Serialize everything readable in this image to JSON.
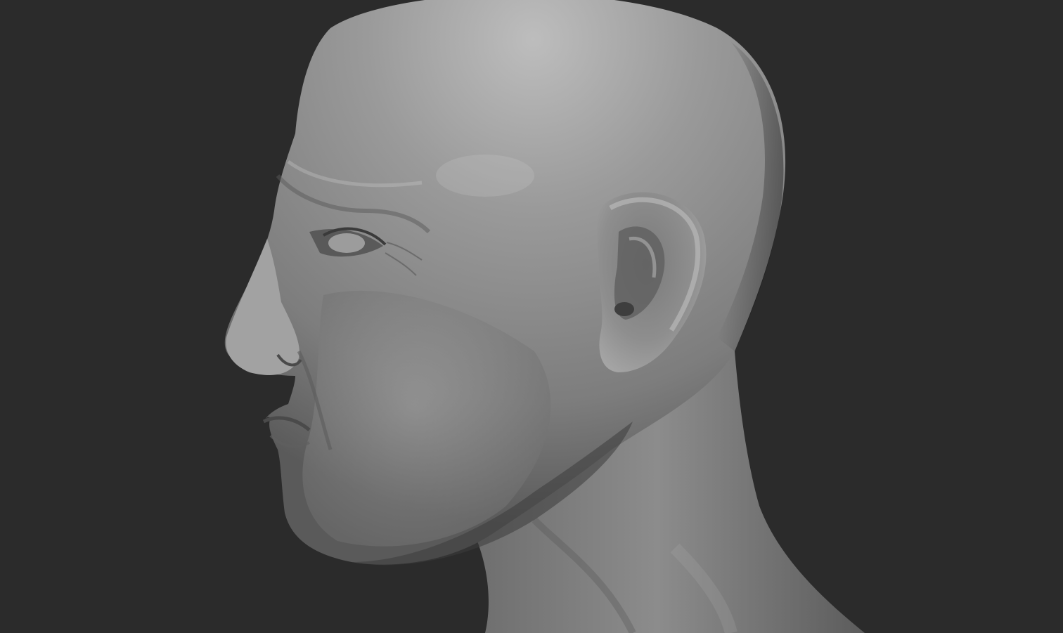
{
  "scene": {
    "background_color": "#2b2b2b",
    "material_base_color": "#8a8a8a",
    "material_highlight_color": "#c4c4c4",
    "material_shadow_color": "#3c3c3c",
    "subject": "head-sculpt-icon"
  }
}
